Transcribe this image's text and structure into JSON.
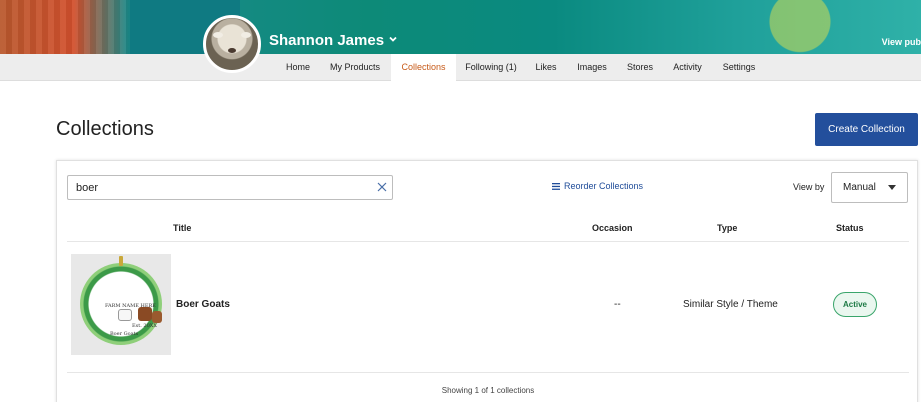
{
  "header": {
    "user_name": "Shannon James",
    "view_public_label": "View pub"
  },
  "nav": {
    "tabs": [
      {
        "label": "Home"
      },
      {
        "label": "My Products"
      },
      {
        "label": "Collections",
        "active": true
      },
      {
        "label": "Following (1)"
      },
      {
        "label": "Likes"
      },
      {
        "label": "Images"
      },
      {
        "label": "Stores"
      },
      {
        "label": "Activity"
      },
      {
        "label": "Settings"
      }
    ]
  },
  "page": {
    "title": "Collections",
    "create_button": "Create Collection"
  },
  "toolbar": {
    "search_value": "boer",
    "reorder_label": "Reorder Collections",
    "view_by_label": "View by",
    "view_by_value": "Manual"
  },
  "table": {
    "columns": [
      "Title",
      "Occasion",
      "Type",
      "Status"
    ],
    "rows": [
      {
        "title": "Boer Goats",
        "occasion": "--",
        "type": "Similar Style / Theme",
        "status": "Active",
        "thumb_text_1": "FARM NAME HERE",
        "thumb_text_2": "Est. 20XX",
        "thumb_text_3": "Boer Goats"
      }
    ],
    "footer": "Showing 1 of 1 collections"
  },
  "colors": {
    "accent_tab": "#c75a18",
    "primary_button": "#234f9c",
    "status_active": "#3aa56b"
  },
  "icons": {
    "search_clear": "close-icon",
    "reorder": "list-icon",
    "dropdown": "caret-down-icon",
    "profile_menu": "chevron-down-icon"
  }
}
